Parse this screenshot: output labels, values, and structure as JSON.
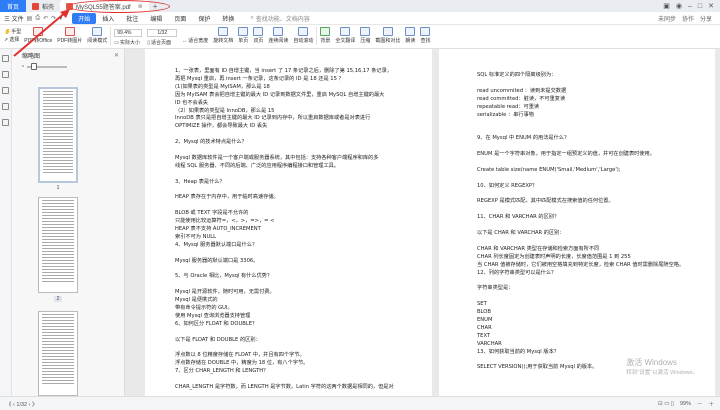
{
  "tabs": {
    "home": "首页",
    "templates": "稻壳",
    "document": "MySQL55题答案.pdf",
    "plus": "+"
  },
  "menu": {
    "file": "三 文件",
    "items": [
      "开始",
      "插入",
      "批注",
      "编辑",
      "页面",
      "保护",
      "转换"
    ],
    "active_index": 0,
    "search": "查找功能、文档内容",
    "right": [
      "未同步",
      "协作",
      "分享"
    ]
  },
  "ribbon": {
    "hand": "手型",
    "select": "选择",
    "pdf_office": "PDF转Office",
    "pdf_image": "PDF转图片",
    "read_mode": "阅读模式",
    "zoom": "99.4%",
    "page": "1/32",
    "actual_size": "实际大小",
    "fit_page": "适合页面",
    "fit_width": "适合宽度",
    "rotate": "旋转文档",
    "single": "单页",
    "double": "双页",
    "continuous": "连续阅读",
    "auto_scroll": "自动滚动",
    "background": "背景",
    "translate": "全文翻译",
    "compress": "压缩",
    "screenshot": "截图和对比",
    "view": "朗读",
    "find": "查找"
  },
  "thumbs": {
    "title": "缩略图",
    "pages": [
      "1",
      "2",
      "3"
    ]
  },
  "left_page_lines": [
    "1、一张表，里面有 ID 自增主键，当 insert 了 17 条记录之后，删除了第 15,16,17 条记录，",
    "再把 Mysql 重启，再 insert 一条记录，这条记录的 ID 是 18 还是 15 ？",
    "(1)如果表的类型是 MyISAM，那么是 18",
    "因为 MyISAM 表会把自增主键的最大 ID 记录到数据文件里，重启 MySQL 自增主键的最大",
    "ID 也不会丢失",
    "（2）如果表的类型是 InnoDB，那么是 15",
    "InnoDB 表只是把自增主键的最大 ID 记录到内存中，所以重启数据库或者是对表进行",
    "OPTIMIZE 操作，都会导致最大 ID 丢失",
    "",
    "2、Mysql 的技术特点是什么？",
    "",
    "Mysql 数据库软件是一个客户端或服务器系统，其中包括：支持各种客户端程序和库的多",
    "线程 SQL 服务器、不同的后端、广泛的应用程序编程接口和管理工具。",
    "",
    "3、Heap 表是什么？",
    "",
    "HEAP 表存在于内存中，用于临时高速存储。",
    "",
    "BLOB 或 TEXT 字段是不允许的",
    "只能使用比较运算符=，<，>，=>，= <",
    "HEAP 表不支持 AUTO_INCREMENT",
    "索引不可为 NULL",
    "4、Mysql 服务器默认端口是什么？",
    "",
    "Mysql 服务器的默认端口是 3306。",
    "",
    "5、与 Oracle 相比，Mysql 有什么优势？",
    "",
    "Mysql 是开源软件，随时可用，无需付费。",
    "Mysql 是便携式的",
    "带有命令提示符的 GUI。",
    "使用 Mysql 查询浏览器支持管理",
    "6、如何区分 FLOAT 和 DOUBLE？",
    "",
    "以下是 FLOAT 和 DOUBLE 的区别：",
    "",
    "浮点数以 8 位精度存储在 FLOAT 中，并且有四个字节。",
    "浮点数存储在 DOUBLE 中，精度为 18 位，有八个字节。",
    "7、区分 CHAR_LENGTH 和 LENGTH？",
    "",
    "CHAR_LENGTH 是字符数，而 LENGTH 是字节数。Latin 字符的这两个数据是相同的，但是对"
  ],
  "right_page_lines": [
    "SQL 标准定义的四个隔离级别为：",
    "",
    "read uncommited ：读到未提交数据",
    "read committed：脏读，不可重复读",
    "repeatable read：可重读",
    "serializable ：串行事物",
    "",
    "",
    "9、在 Mysql 中 ENUM 的用法是什么？",
    "",
    "ENUM 是一个字符串对象，用于指定一组预定义的值，并可在创建表时使用。",
    "",
    "Create table size(name ENUM('Smail,'Medium','Large');",
    "",
    "10、如何定义 REGEXP？",
    "",
    "REGEXP 是模式匹配，其中匹配模式在搜索值的任何位置。",
    "",
    "11、CHAR 和 VARCHAR 的区别？",
    "",
    "以下是 CHAR 和 VARCHAR 的区别：",
    "",
    "CHAR 和 VARCHAR 类型在存储和检索方面有所不同",
    "CHAR 列长度固定为创建表时声明的长度，长度值范围是 1 到 255",
    "当 CHAR 值被存储时，它们被用空格填充到特定长度，检索 CHAR 值时需删除尾随空格。",
    "12、列的字符串类型可以是什么？",
    "",
    "字符串类型是：",
    "",
    "SET",
    "BLOB",
    "ENUM",
    "CHAR",
    "TEXT",
    "VARCHAR",
    "13、如何获取当前的 Mysql 版本？",
    "",
    "SELECT VERSION();用于获取当前 Mysql 的版本。"
  ],
  "status": {
    "nav": "《 ‹ 1/32 › 》",
    "zoom_value": "99%",
    "view_icons": "⊡ ▭ ▯"
  },
  "watermark": {
    "line1": "激活 Windows",
    "line2": "转到\"设置\"以激活 Windows。"
  },
  "colors": {
    "accent": "#2f7df6",
    "annotation": "#e03030"
  }
}
